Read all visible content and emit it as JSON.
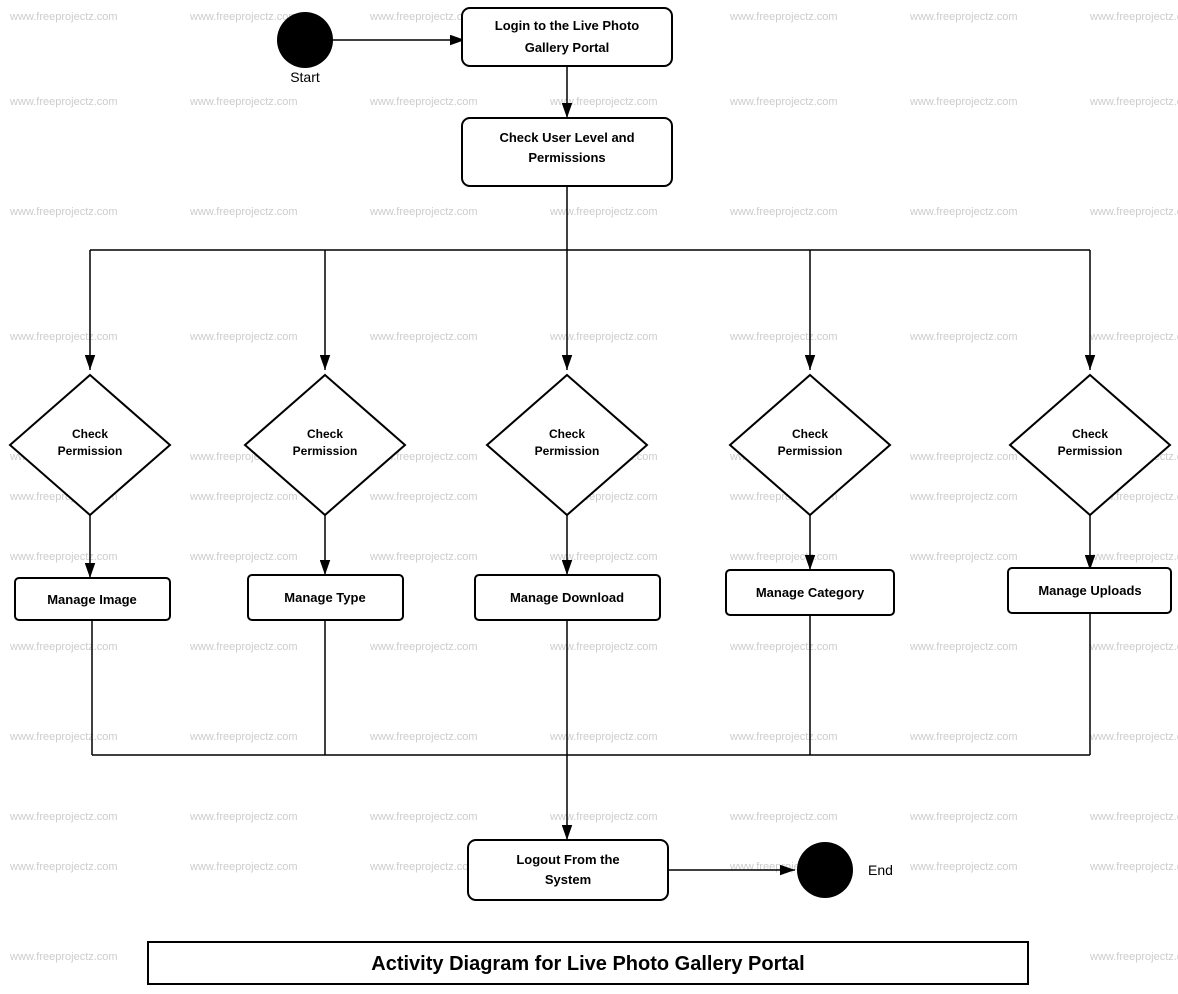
{
  "diagram": {
    "title": "Activity Diagram for Live Photo Gallery Portal",
    "nodes": {
      "start_label": "Start",
      "login_label": "Login to the Live Photo\nGallery Portal",
      "check_permissions_label": "Check User Level and\nPermissions",
      "check_perm1": "Check\nPermission",
      "check_perm2": "Check\nPermission",
      "check_perm3": "Check\nPermission",
      "check_perm4": "Check\nPermission",
      "check_perm5": "Check\nPermission",
      "manage_image": "Manage Image",
      "manage_type": "Manage Type",
      "manage_download": "Manage Download",
      "manage_category": "Manage Category",
      "manage_uploads": "Manage Uploads",
      "logout_label": "Logout From the\nSystem",
      "end_label": "End"
    },
    "watermark": "www.freeprojectz.com"
  }
}
